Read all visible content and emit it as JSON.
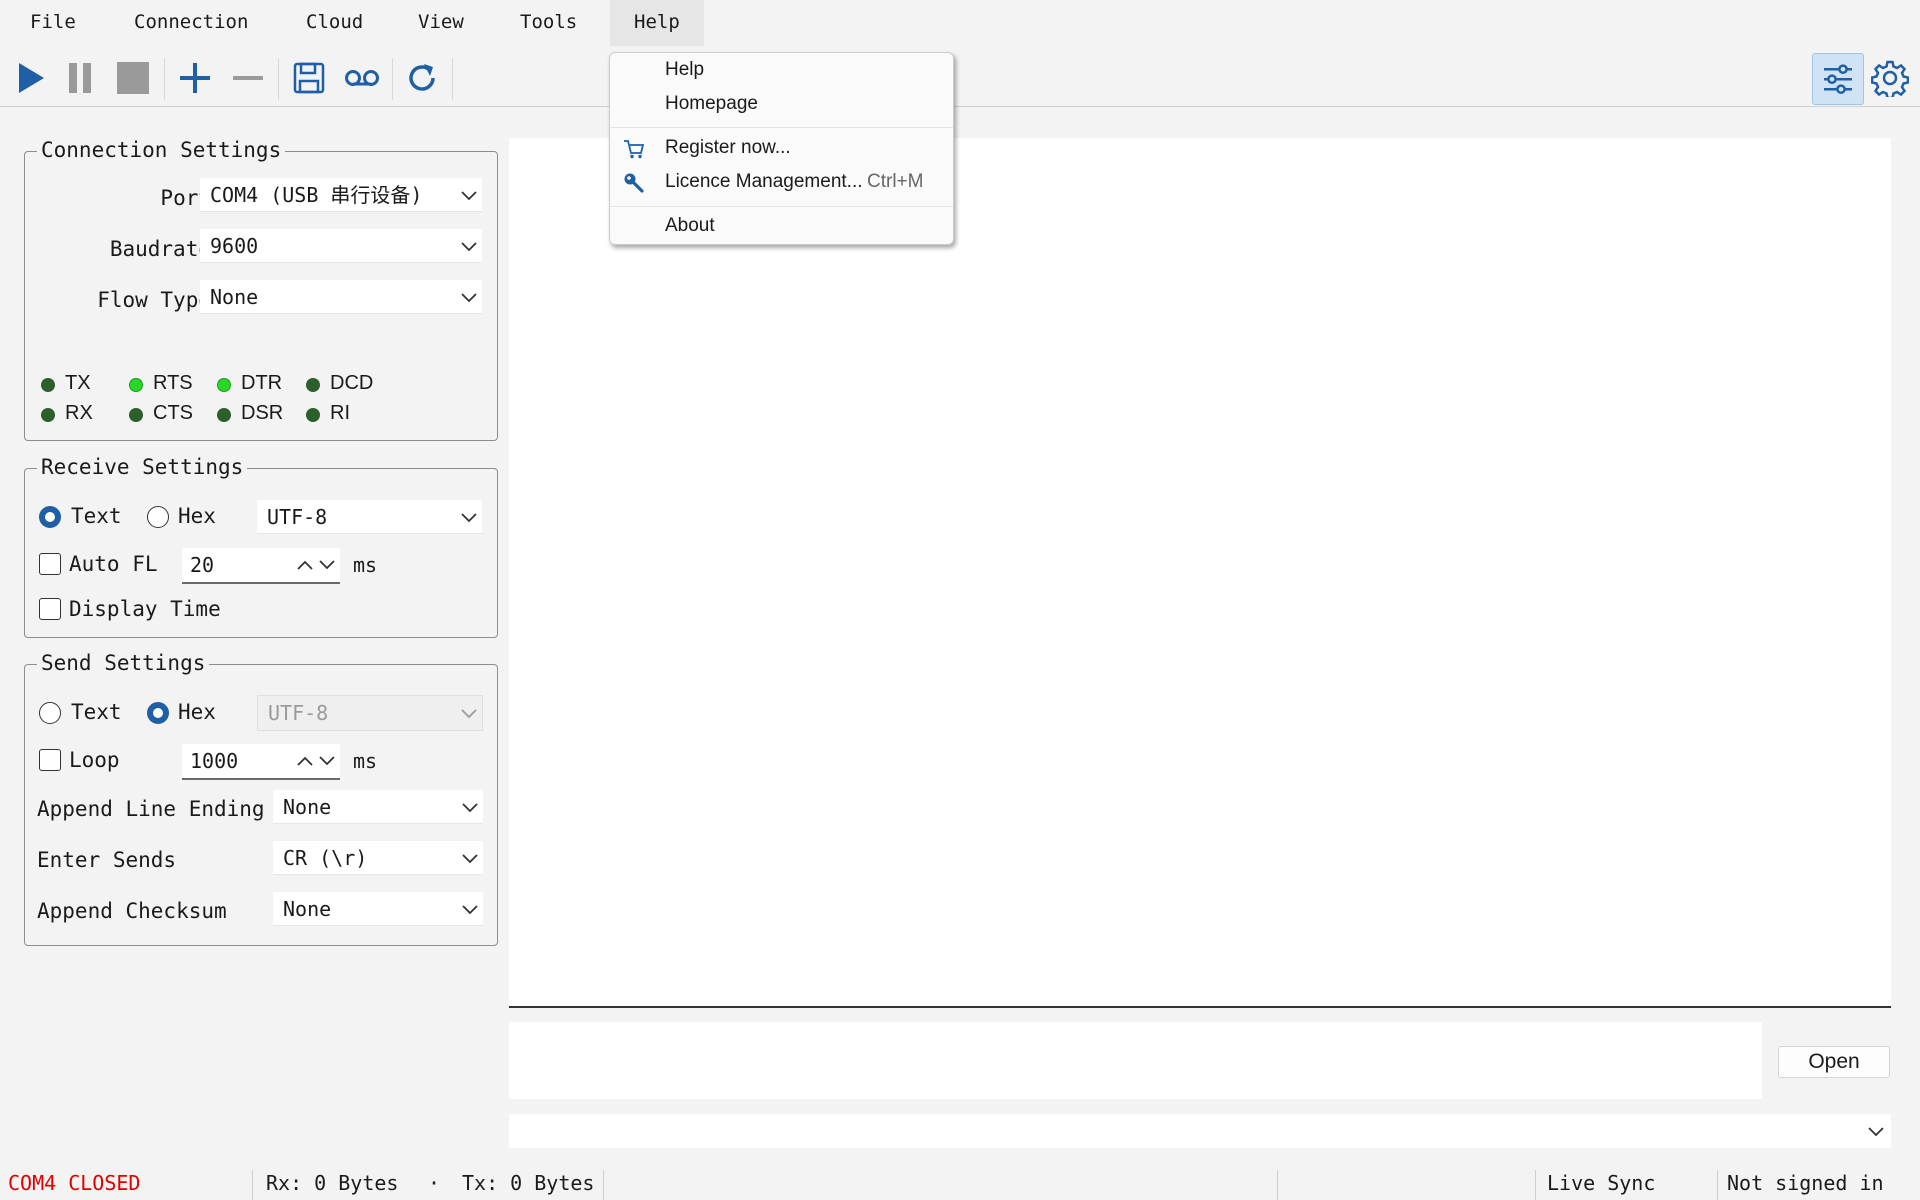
{
  "menubar": {
    "items": [
      "File",
      "Connection",
      "Cloud",
      "View",
      "Tools",
      "Help"
    ]
  },
  "help_menu": {
    "items": [
      {
        "label": "Help",
        "shortcut": "",
        "icon": ""
      },
      {
        "label": "Homepage",
        "shortcut": "",
        "icon": ""
      },
      {
        "label": "Register now...",
        "shortcut": "",
        "icon": "cart-icon"
      },
      {
        "label": "Licence Management...",
        "shortcut": "Ctrl+M",
        "icon": "key-icon"
      },
      {
        "label": "About",
        "shortcut": "",
        "icon": ""
      }
    ]
  },
  "toolbar": {
    "icons": [
      "play-icon",
      "pause-icon",
      "stop-icon",
      "plus-icon",
      "minus-icon",
      "save-icon",
      "record-icon",
      "refresh-icon",
      "sliders-icon",
      "gear-icon"
    ],
    "accent": "#1f5fa6"
  },
  "connection_settings": {
    "title": "Connection Settings",
    "port_label": "Port",
    "port_value": "COM4 (USB 串行设备)",
    "baud_label": "Baudrate",
    "baud_value": "9600",
    "flow_label": "Flow Type",
    "flow_value": "None",
    "leds": [
      {
        "label": "TX",
        "on": false
      },
      {
        "label": "RTS",
        "on": true
      },
      {
        "label": "DTR",
        "on": true
      },
      {
        "label": "DCD",
        "on": false
      },
      {
        "label": "RX",
        "on": false
      },
      {
        "label": "CTS",
        "on": false
      },
      {
        "label": "DSR",
        "on": false
      },
      {
        "label": "RI",
        "on": false
      }
    ]
  },
  "receive_settings": {
    "title": "Receive Settings",
    "text_label": "Text",
    "hex_label": "Hex",
    "encoding": "UTF-8",
    "autofl_label": "Auto FL",
    "autofl_value": "20",
    "ms_label": "ms",
    "display_time_label": "Display Time"
  },
  "send_settings": {
    "title": "Send Settings",
    "text_label": "Text",
    "hex_label": "Hex",
    "encoding": "UTF-8",
    "loop_label": "Loop",
    "loop_value": "1000",
    "ms_label": "ms",
    "append_line_label": "Append Line Ending",
    "append_line_value": "None",
    "enter_sends_label": "Enter Sends",
    "enter_sends_value": "CR (\\r)",
    "append_checksum_label": "Append Checksum",
    "append_checksum_value": "None"
  },
  "main": {
    "open_button": "Open"
  },
  "statusbar": {
    "port_status": "COM4 CLOSED",
    "port_status_color": "#e00000",
    "rx": "Rx: 0 Bytes",
    "dot": "·",
    "tx": "Tx: 0 Bytes",
    "live_sync": "Live Sync",
    "signin": "Not signed in"
  }
}
